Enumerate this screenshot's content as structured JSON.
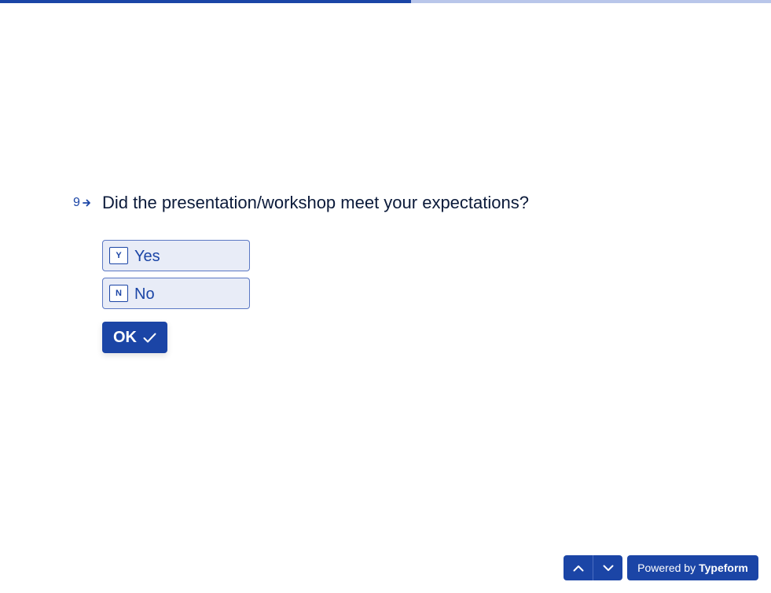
{
  "progress": {
    "fraction": 0.533
  },
  "question": {
    "number": "9",
    "title": "Did the presentation/workshop meet your expectations?"
  },
  "choices": [
    {
      "key": "Y",
      "label": "Yes"
    },
    {
      "key": "N",
      "label": "No"
    }
  ],
  "ok_button": {
    "label": "OK",
    "icon": "checkmark-icon"
  },
  "navigation": {
    "up_icon": "chevron-up-icon",
    "down_icon": "chevron-down-icon"
  },
  "branding": {
    "prefix": "Powered by",
    "name": "Typeform"
  },
  "colors": {
    "accent": "#1b45a6",
    "progress_track": "#b9c6ea",
    "choice_background": "#e8ecf7",
    "question_text": "#0b1a3a"
  }
}
